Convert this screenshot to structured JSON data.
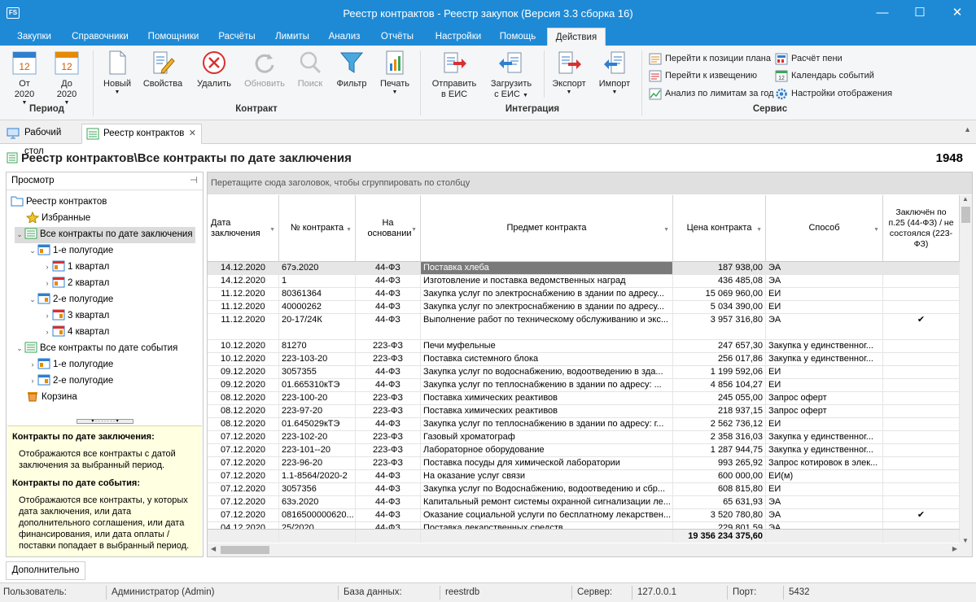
{
  "window": {
    "title": "Реестр контрактов - Реестр закупок (Версия 3.3 сборка 16)",
    "icon_label": "FS"
  },
  "menu": [
    "Закупки",
    "Справочники",
    "Помощники",
    "Расчёты",
    "Лимиты",
    "Анализ",
    "Отчёты",
    "Настройки",
    "Помощь",
    "Действия"
  ],
  "ribbon": {
    "period": {
      "from_label": "От",
      "from_year": "2020",
      "to_label": "До",
      "to_year": "2020",
      "cal_day": "12",
      "group": "Период"
    },
    "contract": {
      "new": "Новый",
      "props": "Свойства",
      "delete": "Удалить",
      "refresh": "Обновить",
      "search": "Поиск",
      "filter": "Фильтр",
      "print": "Печать",
      "group": "Контракт"
    },
    "integration": {
      "send_l1": "Отправить",
      "send_l2": "в ЕИС",
      "load_l1": "Загрузить",
      "load_l2": "с ЕИС",
      "export": "Экспорт",
      "import": "Импорт",
      "group": "Интеграция"
    },
    "service": {
      "goto_plan": "Перейти к позиции плана",
      "goto_notice": "Перейти к извещению",
      "limits_analysis": "Анализ по лимитам за год",
      "penalty_calc": "Расчёт пени",
      "events_calendar": "Календарь событий",
      "display_settings": "Настройки отображения",
      "group": "Сервис"
    }
  },
  "tabs": [
    "Рабочий стол",
    "Реестр контрактов"
  ],
  "page": {
    "heading": "Реестр контрактов\\Все контракты по дате заключения",
    "count": "1948"
  },
  "left": {
    "header": "Просмотр",
    "tree": [
      {
        "label": "Реестр контрактов"
      },
      {
        "label": "Избранные"
      },
      {
        "label": "Все контракты по дате заключения"
      },
      {
        "label": "1-е полугодие"
      },
      {
        "label": "1 квартал"
      },
      {
        "label": "2 квартал"
      },
      {
        "label": "2-е полугодие"
      },
      {
        "label": "3 квартал"
      },
      {
        "label": "4 квартал"
      },
      {
        "label": "Все контракты по дате события"
      },
      {
        "label": "1-е полугодие"
      },
      {
        "label": "2-е полугодие"
      },
      {
        "label": "Корзина"
      }
    ],
    "info": {
      "h1": "Контракты по дате заключения:",
      "p1": "Отображаются все контракты с датой заключения за выбранный период.",
      "h2": "Контракты по дате события:",
      "p2": "Отображаются все контракты, у которых дата заключения, или дата дополнительного соглашения, или дата финансирования,  или дата оплаты / поставки попадает в выбранный период."
    }
  },
  "grid": {
    "group_hint": "Перетащите сюда заголовок, чтобы сгруппировать по столбцу",
    "columns": [
      "Дата заключения",
      "№ контракта",
      "На основании",
      "Предмет контракта",
      "Цена контракта",
      "Способ",
      "Заключён по п.25 (44-ФЗ) / не состоялся (223-ФЗ)"
    ],
    "rows": [
      {
        "date": "14.12.2020",
        "num": "67э.2020",
        "basis": "44-ФЗ",
        "subject": "Поставка хлеба",
        "price": "187 938,00",
        "method": "ЭА",
        "flag": ""
      },
      {
        "date": "14.12.2020",
        "num": "1",
        "basis": "44-ФЗ",
        "subject": "Изготовление и поставка ведомственных наград",
        "price": "436 485,08",
        "method": "ЭА",
        "flag": ""
      },
      {
        "date": "11.12.2020",
        "num": "80361364",
        "basis": "44-ФЗ",
        "subject": "Закупка услуг по электроснабжению в здании по адресу...",
        "price": "15 069 960,00",
        "method": "ЕИ",
        "flag": ""
      },
      {
        "date": "11.12.2020",
        "num": "40000262",
        "basis": "44-ФЗ",
        "subject": "Закупка услуг по электроснабжению в здании по адресу...",
        "price": "5 034 390,00",
        "method": "ЕИ",
        "flag": ""
      },
      {
        "date": "11.12.2020",
        "num": "20-17/24К",
        "basis": "44-ФЗ",
        "subject": "Выполнение работ по техническому обслуживанию и экс...",
        "price": "3 957 316,80",
        "method": "ЭА",
        "flag": "✔"
      },
      {
        "date": "10.12.2020",
        "num": "81270",
        "basis": "223-ФЗ",
        "subject": "Печи муфельные",
        "price": "247 657,30",
        "method": "Закупка у единственног...",
        "flag": ""
      },
      {
        "date": "10.12.2020",
        "num": "223-103-20",
        "basis": "223-ФЗ",
        "subject": "Поставка системного блока",
        "price": "256 017,86",
        "method": "Закупка у единственног...",
        "flag": ""
      },
      {
        "date": "09.12.2020",
        "num": "3057355",
        "basis": "44-ФЗ",
        "subject": "Закупка услуг по водоснабжению, водоотведению в зда...",
        "price": "1 199 592,06",
        "method": "ЕИ",
        "flag": ""
      },
      {
        "date": "09.12.2020",
        "num": "01.665310кТЭ",
        "basis": "44-ФЗ",
        "subject": "Закупка услуг по теплоснабжению в здании по адресу: ...",
        "price": "4 856 104,27",
        "method": "ЕИ",
        "flag": ""
      },
      {
        "date": "08.12.2020",
        "num": "223-100-20",
        "basis": "223-ФЗ",
        "subject": "Поставка химических реактивов",
        "price": "245 055,00",
        "method": "Запрос оферт",
        "flag": ""
      },
      {
        "date": "08.12.2020",
        "num": "223-97-20",
        "basis": "223-ФЗ",
        "subject": "Поставка химических реактивов",
        "price": "218 937,15",
        "method": "Запрос оферт",
        "flag": ""
      },
      {
        "date": "08.12.2020",
        "num": "01.645029кТЭ",
        "basis": "44-ФЗ",
        "subject": "Закупка услуг по теплоснабжению в здании по адресу: г...",
        "price": "2 562 736,12",
        "method": "ЕИ",
        "flag": ""
      },
      {
        "date": "07.12.2020",
        "num": "223-102-20",
        "basis": "223-ФЗ",
        "subject": "Газовый хроматограф",
        "price": "2 358 316,03",
        "method": "Закупка у единственног...",
        "flag": ""
      },
      {
        "date": "07.12.2020",
        "num": "223-101--20",
        "basis": "223-ФЗ",
        "subject": "Лабораторное оборудование",
        "price": "1 287 944,75",
        "method": "Закупка у единственног...",
        "flag": ""
      },
      {
        "date": "07.12.2020",
        "num": "223-96-20",
        "basis": "223-ФЗ",
        "subject": "Поставка посуды для химической лаборатории",
        "price": "993 265,92",
        "method": "Запрос котировок в элек...",
        "flag": ""
      },
      {
        "date": "07.12.2020",
        "num": "1.1-8564/2020-2",
        "basis": "44-ФЗ",
        "subject": "На оказание услуг связи",
        "price": "600 000,00",
        "method": "ЕИ(м)",
        "flag": ""
      },
      {
        "date": "07.12.2020",
        "num": "3057356",
        "basis": "44-ФЗ",
        "subject": "Закупка услуг по Водоснабжению, водоотведению и сбр...",
        "price": "608 815,80",
        "method": "ЕИ",
        "flag": ""
      },
      {
        "date": "07.12.2020",
        "num": "63э.2020",
        "basis": "44-ФЗ",
        "subject": "Капитальный ремонт системы охранной сигнализации ле...",
        "price": "65 631,93",
        "method": "ЭА",
        "flag": ""
      },
      {
        "date": "07.12.2020",
        "num": "0816500000620...",
        "basis": "44-ФЗ",
        "subject": "Оказание социальной услуги по бесплатному лекарствен...",
        "price": "3 520 780,80",
        "method": "ЭА",
        "flag": "✔"
      },
      {
        "date": "04.12.2020",
        "num": "25/2020",
        "basis": "44-ФЗ",
        "subject": "Поставка лекарственных средств",
        "price": "229 801,59",
        "method": "ЭА",
        "flag": ""
      }
    ],
    "total": "19 356 234 375,60"
  },
  "bottom_tab": "Дополнительно",
  "status": {
    "user_label": "Пользователь:",
    "user": "Администратор (Admin)",
    "db_label": "База данных:",
    "db": "reestrdb",
    "server_label": "Сервер:",
    "server": "127.0.0.1",
    "port_label": "Порт:",
    "port": "5432"
  }
}
